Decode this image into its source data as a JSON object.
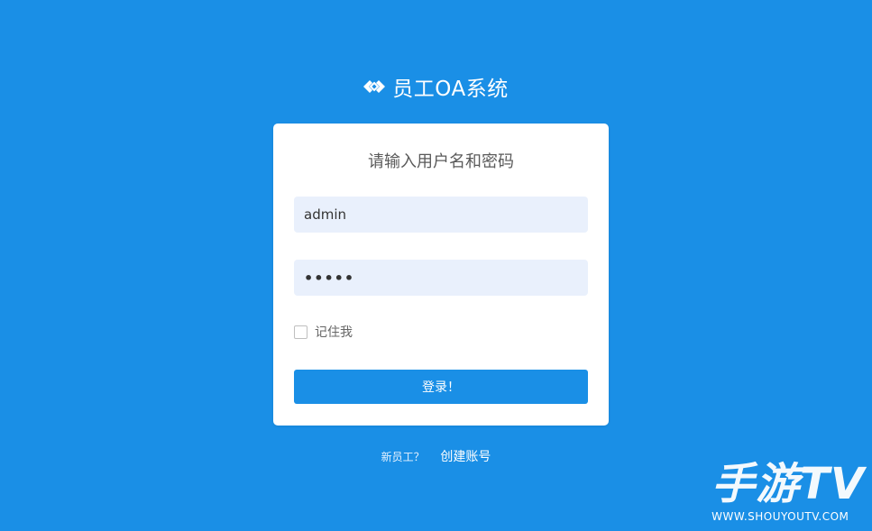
{
  "app": {
    "title": "员工OA系统",
    "brand_icon": "diamond-link-icon"
  },
  "login": {
    "heading": "请输入用户名和密码",
    "username_value": "admin",
    "password_value": "•••••",
    "remember_label": "记住我",
    "remember_checked": false,
    "submit_label": "登录！"
  },
  "footer": {
    "question": "新员工？",
    "register_link": "创建账号"
  },
  "watermark": {
    "name": "手游TV",
    "url": "WWW.SHOUYOUTV.COM"
  },
  "colors": {
    "background": "#1a8fe6",
    "input_bg": "#e9f0fc",
    "button": "#1a8fe6"
  }
}
